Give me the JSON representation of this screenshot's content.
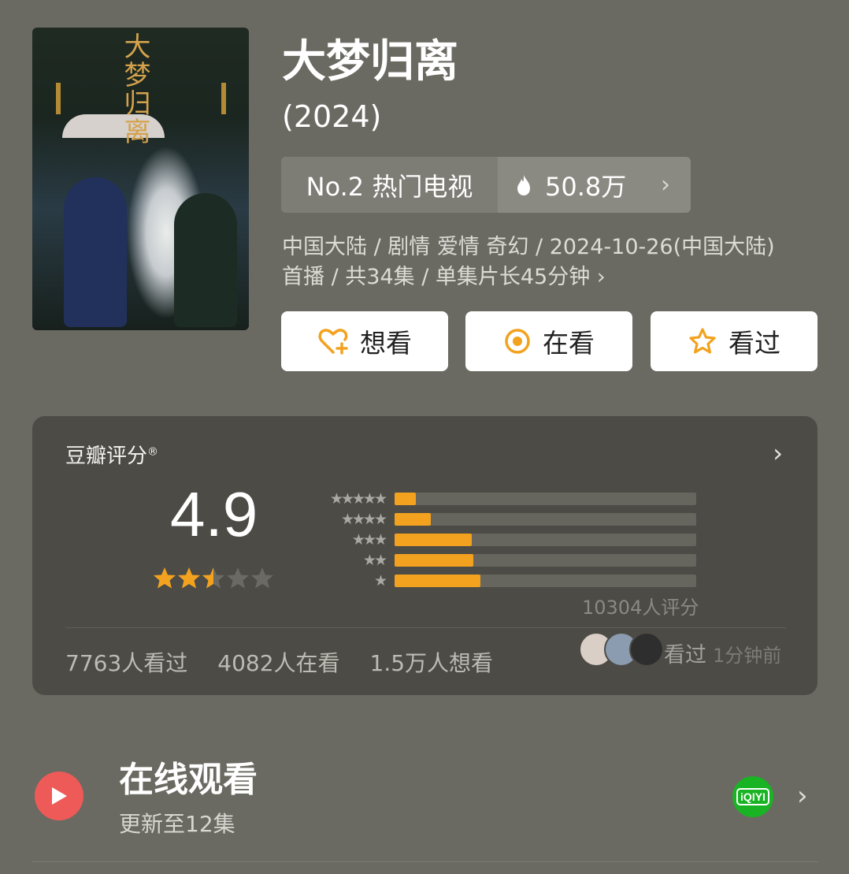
{
  "poster": {
    "title_text": "大梦归离"
  },
  "header": {
    "title": "大梦归离",
    "year": "(2024)"
  },
  "rank": {
    "label": "No.2 热门电视",
    "heat": "50.8万",
    "chevron": "›"
  },
  "meta": {
    "line1": "中国大陆 / 剧情 爱情 奇幻 / 2024-10-26(中国大陆)",
    "line2": "首播 / 共34集 / 单集片长45分钟 ›"
  },
  "actions": {
    "want": "想看",
    "watching": "在看",
    "watched": "看过"
  },
  "rating": {
    "label": "豆瓣评分",
    "mark": "®",
    "chevron": "›",
    "score": "4.9",
    "stars_value": 2.5,
    "stars_max": 5,
    "distribution": [
      {
        "stars": "★★★★★",
        "fraction": 0.07
      },
      {
        "stars": "★★★★",
        "fraction": 0.12
      },
      {
        "stars": "★★★",
        "fraction": 0.255
      },
      {
        "stars": "★★",
        "fraction": 0.26
      },
      {
        "stars": "★",
        "fraction": 0.285
      }
    ],
    "count": "10304人评分",
    "stats": {
      "watched": "7763人看过",
      "watching": "4082人在看",
      "want": "1.5万人想看"
    },
    "recent": {
      "action": "看过",
      "time": "1分钟前"
    }
  },
  "online": {
    "title": "在线观看",
    "subtitle": "更新至12集",
    "platform_label": "iQIYI",
    "chevron": "›"
  },
  "colors": {
    "background": "#6b6a62",
    "card": "#4c4b45",
    "accent_orange": "#f3a21f",
    "play_red": "#ee5a57",
    "iqiyi_green": "#19b423"
  }
}
